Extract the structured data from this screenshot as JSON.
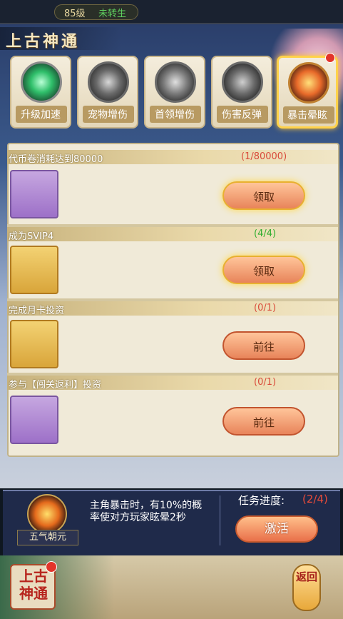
{
  "status": {
    "level": "85级",
    "rebirth": "未转生"
  },
  "title": "上古神通",
  "tabs": [
    {
      "label": "升级加速",
      "icon": "jade-orb-icon",
      "color": "#2fbf6a"
    },
    {
      "label": "宠物增伤",
      "icon": "beast-icon",
      "color": "#7a7a7a"
    },
    {
      "label": "首领增伤",
      "icon": "sword-icon",
      "color": "#7a7a7a"
    },
    {
      "label": "伤害反弹",
      "icon": "armor-icon",
      "color": "#7a7a7a"
    },
    {
      "label": "暴击晕眩",
      "icon": "warrior-flame-icon",
      "color": "#e86a2a",
      "active": true
    }
  ],
  "tasks": [
    {
      "title": "代币卷消耗达到80000",
      "progress": "(1/80000)",
      "progress_color": "red",
      "button": "领取",
      "chest": "purple",
      "glow": true
    },
    {
      "title": "成为SVIP4",
      "progress": "(4/4)",
      "progress_color": "green",
      "button": "领取",
      "chest": "gold",
      "glow": true
    },
    {
      "title": "完成月卡投资",
      "progress": "(0/1)",
      "progress_color": "red",
      "button": "前往",
      "chest": "gold",
      "glow": false
    },
    {
      "title": "参与【闯关返利】投资",
      "progress": "(0/1)",
      "progress_color": "red",
      "button": "前往",
      "chest": "purple",
      "glow": false
    }
  ],
  "skill": {
    "name": "五气朝元",
    "description": "主角暴击时，有10%的概率使对方玩家眩晕2秒",
    "task_label": "任务进度:",
    "task_value": "(2/4)",
    "activate": "激活"
  },
  "footer": {
    "logo": "上古神通",
    "back": "返回"
  }
}
